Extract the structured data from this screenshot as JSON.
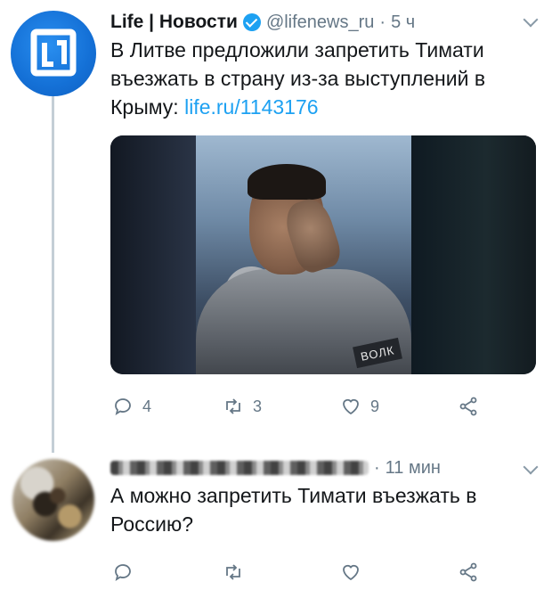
{
  "tweet1": {
    "name": "Life | Новости",
    "handle": "@lifenews_ru",
    "separator": "·",
    "time": "5 ч",
    "text": "В Литве предложили запретить Тимати въезжать в страну из-за выступлений в Крыму: ",
    "link": "life.ru/1143176",
    "media_patch_text": "ВОЛК",
    "actions": {
      "replies": "4",
      "retweets": "3",
      "likes": "9"
    }
  },
  "tweet2": {
    "separator": "·",
    "time": "11 мин",
    "text": "А можно запретить Тимати въезжать в Россию?"
  },
  "icons": [
    "reply-icon",
    "retweet-icon",
    "like-icon",
    "share-icon",
    "verified-icon",
    "chevron-down-icon"
  ],
  "colors": {
    "accent": "#1da1f2",
    "muted": "#657786",
    "thread_line": "#c4ced6"
  }
}
